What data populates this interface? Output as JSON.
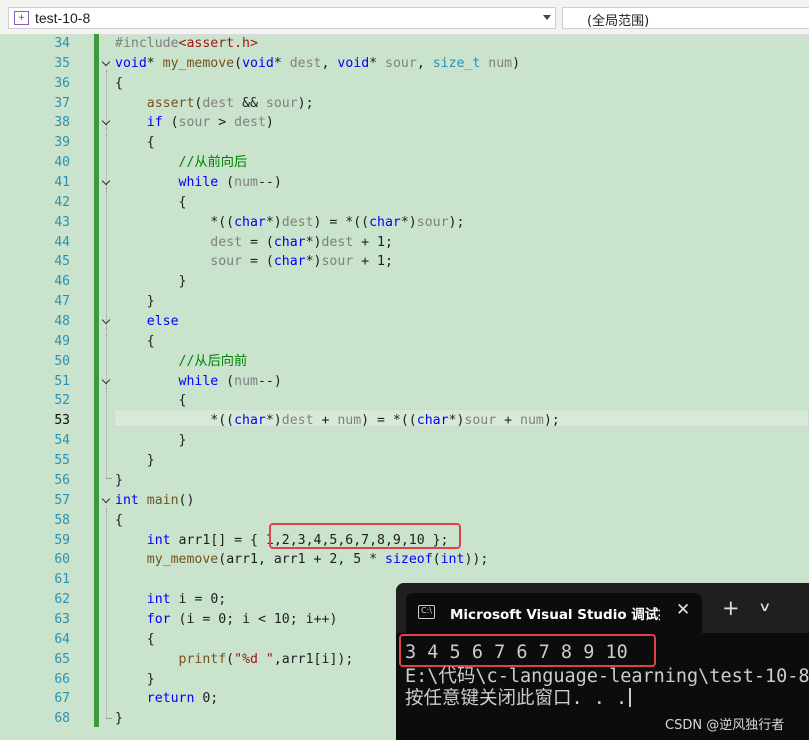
{
  "toolbar": {
    "file_icon": "cpp-project-icon",
    "file_name": "test-10-8",
    "scope": "(全局范围)"
  },
  "editor": {
    "current_line": "53",
    "lines": [
      {
        "n": "34",
        "code": "#include<assert.h>"
      },
      {
        "n": "35",
        "code": "void* my_memove(void* dest, void* sour, size_t num)"
      },
      {
        "n": "36",
        "code": "{"
      },
      {
        "n": "37",
        "code": "    assert(dest && sour);"
      },
      {
        "n": "38",
        "code": "    if (sour > dest)"
      },
      {
        "n": "39",
        "code": "    {"
      },
      {
        "n": "40",
        "code": "        //从前向后"
      },
      {
        "n": "41",
        "code": "        while (num--)"
      },
      {
        "n": "42",
        "code": "        {"
      },
      {
        "n": "43",
        "code": "            *((char*)dest) = *((char*)sour);"
      },
      {
        "n": "44",
        "code": "            dest = (char*)dest + 1;"
      },
      {
        "n": "45",
        "code": "            sour = (char*)sour + 1;"
      },
      {
        "n": "46",
        "code": "        }"
      },
      {
        "n": "47",
        "code": "    }"
      },
      {
        "n": "48",
        "code": "    else"
      },
      {
        "n": "49",
        "code": "    {"
      },
      {
        "n": "50",
        "code": "        //从后向前"
      },
      {
        "n": "51",
        "code": "        while (num--)"
      },
      {
        "n": "52",
        "code": "        {"
      },
      {
        "n": "53",
        "code": "            *((char*)dest + num) = *((char*)sour + num);"
      },
      {
        "n": "54",
        "code": "        }"
      },
      {
        "n": "55",
        "code": "    }"
      },
      {
        "n": "56",
        "code": "}"
      },
      {
        "n": "57",
        "code": "int main()"
      },
      {
        "n": "58",
        "code": "{"
      },
      {
        "n": "59",
        "code": "    int arr1[] = { 1,2,3,4,5,6,7,8,9,10 };"
      },
      {
        "n": "60",
        "code": "    my_memove(arr1, arr1 + 2, 5 * sizeof(int));"
      },
      {
        "n": "61",
        "code": ""
      },
      {
        "n": "62",
        "code": "    int i = 0;"
      },
      {
        "n": "63",
        "code": "    for (i = 0; i < 10; i++)"
      },
      {
        "n": "64",
        "code": "    {"
      },
      {
        "n": "65",
        "code": "        printf(\"%d \",arr1[i]);"
      },
      {
        "n": "66",
        "code": "    }"
      },
      {
        "n": "67",
        "code": "    return 0;"
      },
      {
        "n": "68",
        "code": "}"
      }
    ]
  },
  "console": {
    "tab_icon": "terminal-icon",
    "tab_title": "Microsoft Visual Studio 调试控制台",
    "close_glyph": "✕",
    "new_tab_glyph": "+",
    "dropdown_glyph": "∨",
    "output_line": "3 4 5 6 7 6 7 8 9 10",
    "path_line": "E:\\代码\\c-language-learning\\test-10-8",
    "prompt_line": "按任意键关闭此窗口. . ."
  },
  "watermark": "CSDN @逆风独行者",
  "colors": {
    "editor_bg": "#c9e3cd",
    "keyword": "#0000ff",
    "type_name": "#2b91af",
    "comment": "#008000",
    "highlight_box": "#e0404a",
    "console_bg": "#0c0c0c"
  }
}
